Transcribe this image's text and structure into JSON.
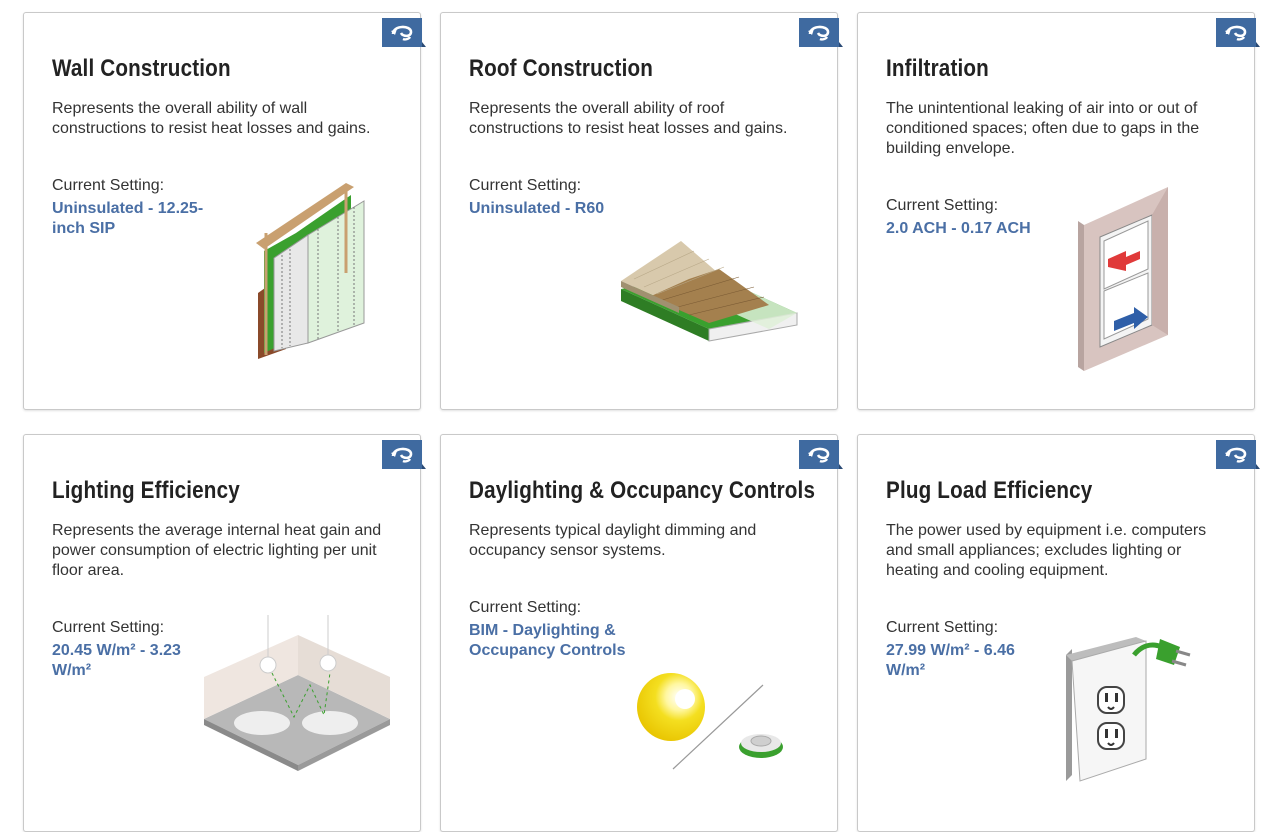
{
  "cards": [
    {
      "title": "Wall Construction",
      "description": "Represents the overall ability of wall constructions to resist heat losses and gains.",
      "setting_label": "Current Setting:",
      "setting_value": "Uninsulated - 12.25-inch SIP",
      "flag_icon": "swap-icon"
    },
    {
      "title": "Roof Construction",
      "description": "Represents the overall ability of roof constructions to resist heat losses and gains.",
      "setting_label": "Current Setting:",
      "setting_value": "Uninsulated - R60",
      "flag_icon": "swap-icon"
    },
    {
      "title": "Infiltration",
      "description": "The unintentional leaking of air into or out of conditioned spaces; often due to gaps in the building envelope.",
      "setting_label": "Current Setting:",
      "setting_value": "2.0 ACH - 0.17 ACH",
      "flag_icon": "swap-icon"
    },
    {
      "title": "Lighting Efficiency",
      "description": "Represents the average internal heat gain and power consumption of electric lighting per unit floor area.",
      "setting_label": "Current Setting:",
      "setting_value": "20.45 W/m² - 3.23 W/m²",
      "flag_icon": "swap-icon"
    },
    {
      "title": "Daylighting & Occupancy Controls",
      "description": "Represents typical daylight dimming and occupancy sensor systems.",
      "setting_label": "Current Setting:",
      "setting_value": "BIM - Daylighting & Occupancy Controls",
      "flag_icon": "swap-icon"
    },
    {
      "title": "Plug Load Efficiency",
      "description": "The power used by equipment i.e. computers and small appliances; excludes lighting or heating and cooling equipment.",
      "setting_label": "Current Setting:",
      "setting_value": "27.99 W/m² - 6.46 W/m²",
      "flag_icon": "swap-icon"
    }
  ],
  "colors": {
    "accent": "#4a6fa5",
    "flag": "#3f6aa0",
    "title": "#222222",
    "text": "#333333",
    "insulation_green": "#3aa02e"
  }
}
